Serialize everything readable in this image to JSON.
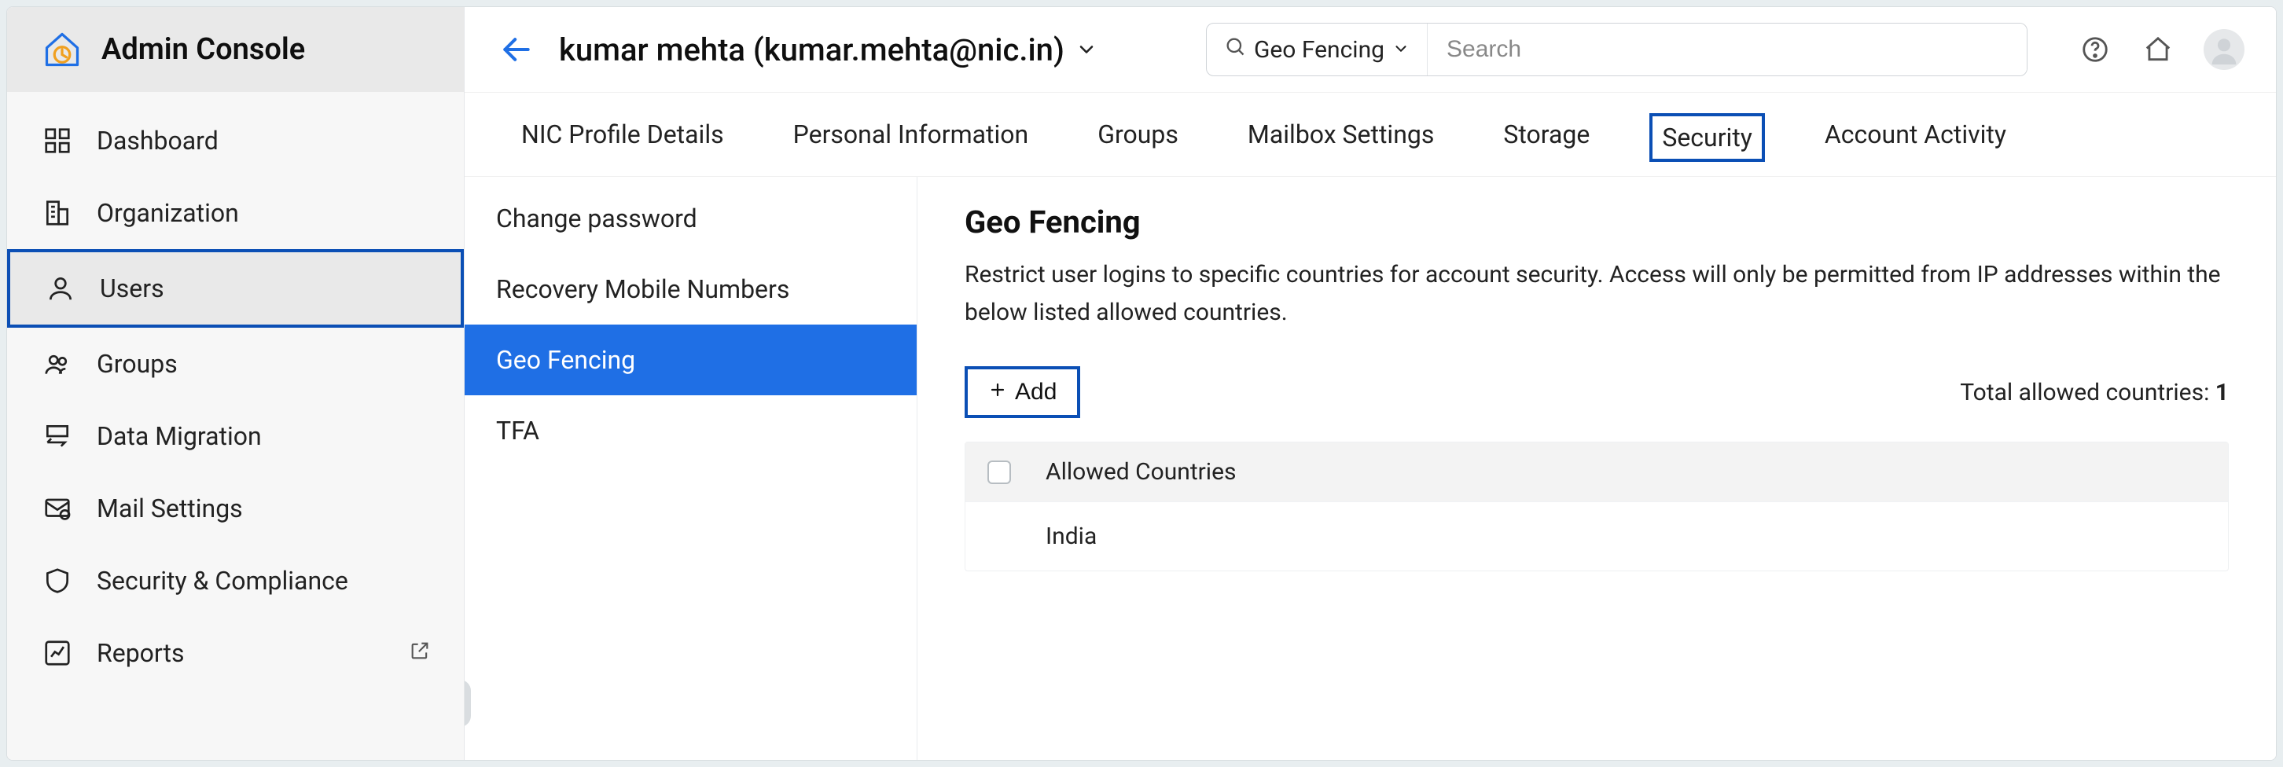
{
  "brand": {
    "title": "Admin Console"
  },
  "sidebar": {
    "items": [
      {
        "label": "Dashboard"
      },
      {
        "label": "Organization"
      },
      {
        "label": "Users"
      },
      {
        "label": "Groups"
      },
      {
        "label": "Data Migration"
      },
      {
        "label": "Mail Settings"
      },
      {
        "label": "Security & Compliance"
      },
      {
        "label": "Reports"
      }
    ]
  },
  "header": {
    "user_display": "kumar mehta (kumar.mehta@nic.in)",
    "search_scope": "Geo Fencing",
    "search_placeholder": "Search"
  },
  "tabs": [
    {
      "label": "NIC Profile Details"
    },
    {
      "label": "Personal Information"
    },
    {
      "label": "Groups"
    },
    {
      "label": "Mailbox Settings"
    },
    {
      "label": "Storage"
    },
    {
      "label": "Security"
    },
    {
      "label": "Account Activity"
    }
  ],
  "subnav": [
    {
      "label": "Change password"
    },
    {
      "label": "Recovery Mobile Numbers"
    },
    {
      "label": "Geo Fencing"
    },
    {
      "label": "TFA"
    }
  ],
  "geo": {
    "title": "Geo Fencing",
    "description": "Restrict user logins to specific countries for account security. Access will only be permitted from IP addresses within the below listed allowed countries.",
    "add_label": "Add",
    "total_label": "Total allowed countries: ",
    "total_count": "1",
    "column_header": "Allowed Countries",
    "rows": [
      {
        "country": "India"
      }
    ]
  }
}
